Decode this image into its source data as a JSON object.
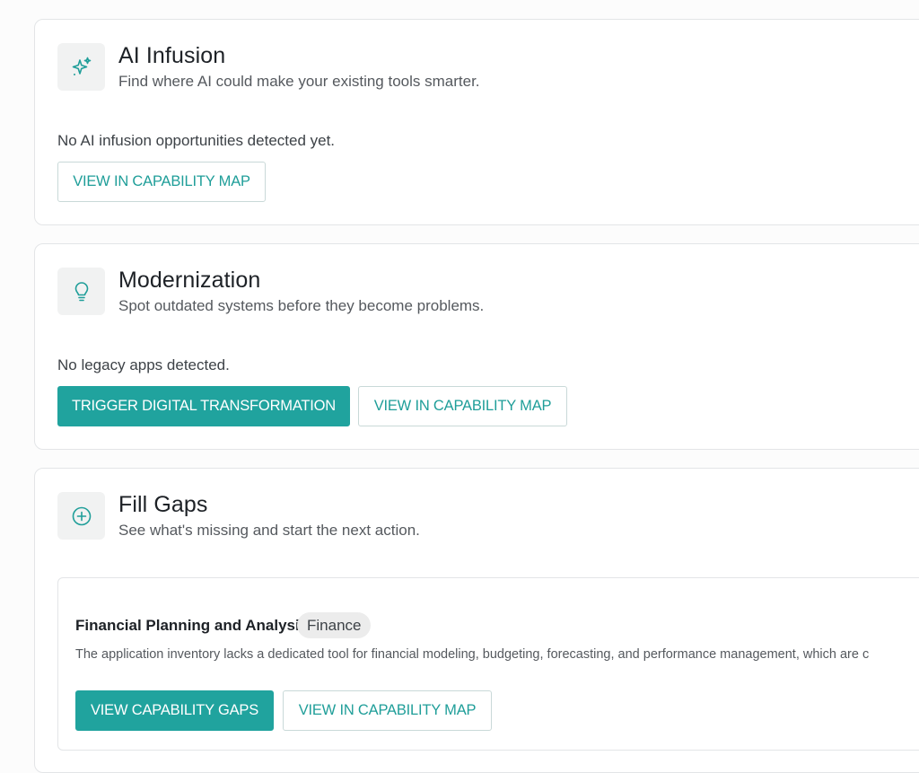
{
  "sections": [
    {
      "icon": "sparkles-icon",
      "title": "AI Infusion",
      "subtitle": "Find where AI could make your existing tools smarter.",
      "empty_text": "No AI infusion opportunities detected yet.",
      "map_button_label": "VIEW IN CAPABILITY MAP"
    },
    {
      "icon": "lightbulb-icon",
      "title": "Modernization",
      "subtitle": "Spot outdated systems before they become problems.",
      "empty_text": "No legacy apps detected.",
      "primary_button_label": "TRIGGER DIGITAL TRANSFORMATION",
      "map_button_label": "VIEW IN CAPABILITY MAP"
    },
    {
      "icon": "plus-circle-icon",
      "title": "Fill Gaps",
      "subtitle": "See what's missing and start the next action.",
      "items": [
        {
          "title": "Financial Planning and Analysis",
          "badge": "Finance",
          "description": "The application inventory lacks a dedicated tool for financial modeling, budgeting, forecasting, and performance management, which are c",
          "primary_button_label": "VIEW CAPABILITY GAPS",
          "map_button_label": "VIEW IN CAPABILITY MAP"
        }
      ]
    }
  ],
  "colors": {
    "accent": "#20a39e",
    "accent_text": "#1f9e99",
    "icon_tile_bg": "#f1f2f2",
    "badge_bg": "#ececec"
  }
}
